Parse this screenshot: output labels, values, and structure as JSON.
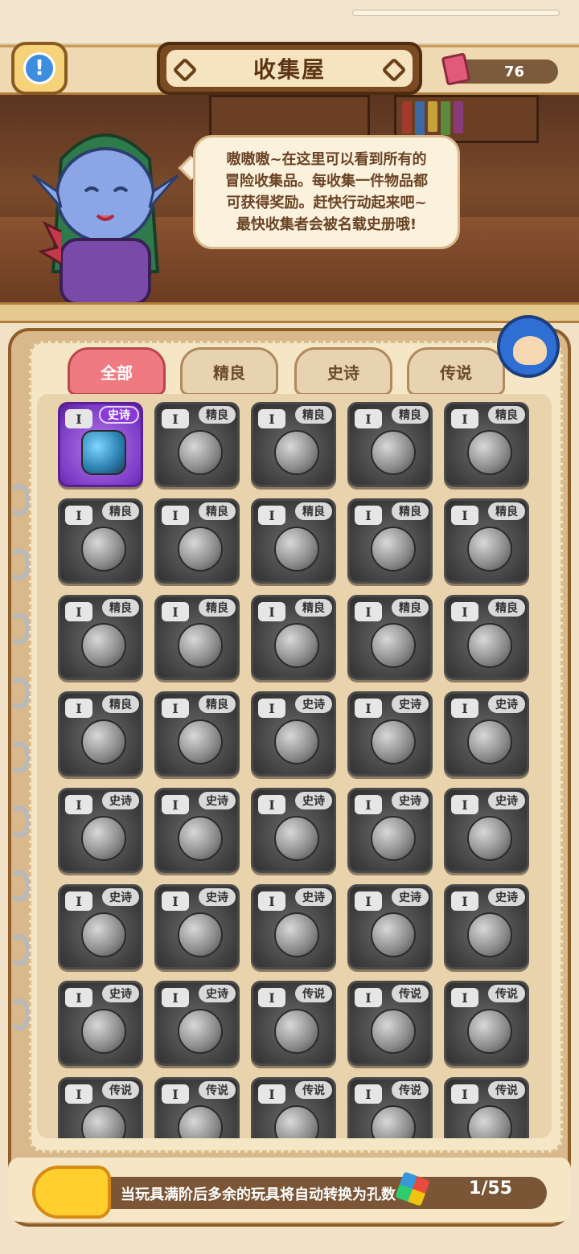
{
  "header": {
    "title": "收集屋",
    "scroll_count": "76"
  },
  "dialog": {
    "lines": [
      "嗷嗷嗷~在这里可以看到所有的",
      "冒险收集品。每收集一件物品都",
      "可获得奖励。赶快行动起来吧~",
      "最快收集者会被名载史册哦!"
    ]
  },
  "tabs": [
    {
      "label": "全部",
      "active": true
    },
    {
      "label": "精良",
      "active": false
    },
    {
      "label": "史诗",
      "active": false
    },
    {
      "label": "传说",
      "active": false
    }
  ],
  "items": [
    {
      "level": "I",
      "rarity": "史诗",
      "unlocked": true
    },
    {
      "level": "I",
      "rarity": "精良"
    },
    {
      "level": "I",
      "rarity": "精良"
    },
    {
      "level": "I",
      "rarity": "精良"
    },
    {
      "level": "I",
      "rarity": "精良"
    },
    {
      "level": "I",
      "rarity": "精良"
    },
    {
      "level": "I",
      "rarity": "精良"
    },
    {
      "level": "I",
      "rarity": "精良"
    },
    {
      "level": "I",
      "rarity": "精良"
    },
    {
      "level": "I",
      "rarity": "精良"
    },
    {
      "level": "I",
      "rarity": "精良"
    },
    {
      "level": "I",
      "rarity": "精良"
    },
    {
      "level": "I",
      "rarity": "精良"
    },
    {
      "level": "I",
      "rarity": "精良"
    },
    {
      "level": "I",
      "rarity": "精良"
    },
    {
      "level": "I",
      "rarity": "精良"
    },
    {
      "level": "I",
      "rarity": "精良"
    },
    {
      "level": "I",
      "rarity": "史诗"
    },
    {
      "level": "I",
      "rarity": "史诗"
    },
    {
      "level": "I",
      "rarity": "史诗"
    },
    {
      "level": "I",
      "rarity": "史诗"
    },
    {
      "level": "I",
      "rarity": "史诗"
    },
    {
      "level": "I",
      "rarity": "史诗"
    },
    {
      "level": "I",
      "rarity": "史诗"
    },
    {
      "level": "I",
      "rarity": "史诗"
    },
    {
      "level": "I",
      "rarity": "史诗"
    },
    {
      "level": "I",
      "rarity": "史诗"
    },
    {
      "level": "I",
      "rarity": "史诗"
    },
    {
      "level": "I",
      "rarity": "史诗"
    },
    {
      "level": "I",
      "rarity": "史诗"
    },
    {
      "level": "I",
      "rarity": "史诗"
    },
    {
      "level": "I",
      "rarity": "史诗"
    },
    {
      "level": "I",
      "rarity": "传说"
    },
    {
      "level": "I",
      "rarity": "传说"
    },
    {
      "level": "I",
      "rarity": "传说"
    },
    {
      "level": "I",
      "rarity": "传说"
    },
    {
      "level": "I",
      "rarity": "传说"
    },
    {
      "level": "I",
      "rarity": "传说"
    },
    {
      "level": "I",
      "rarity": "传说"
    },
    {
      "level": "I",
      "rarity": "传说"
    }
  ],
  "footer": {
    "message": "当玩具满阶后多余的玩具将自动转换为孔数",
    "progress": "1/55"
  }
}
